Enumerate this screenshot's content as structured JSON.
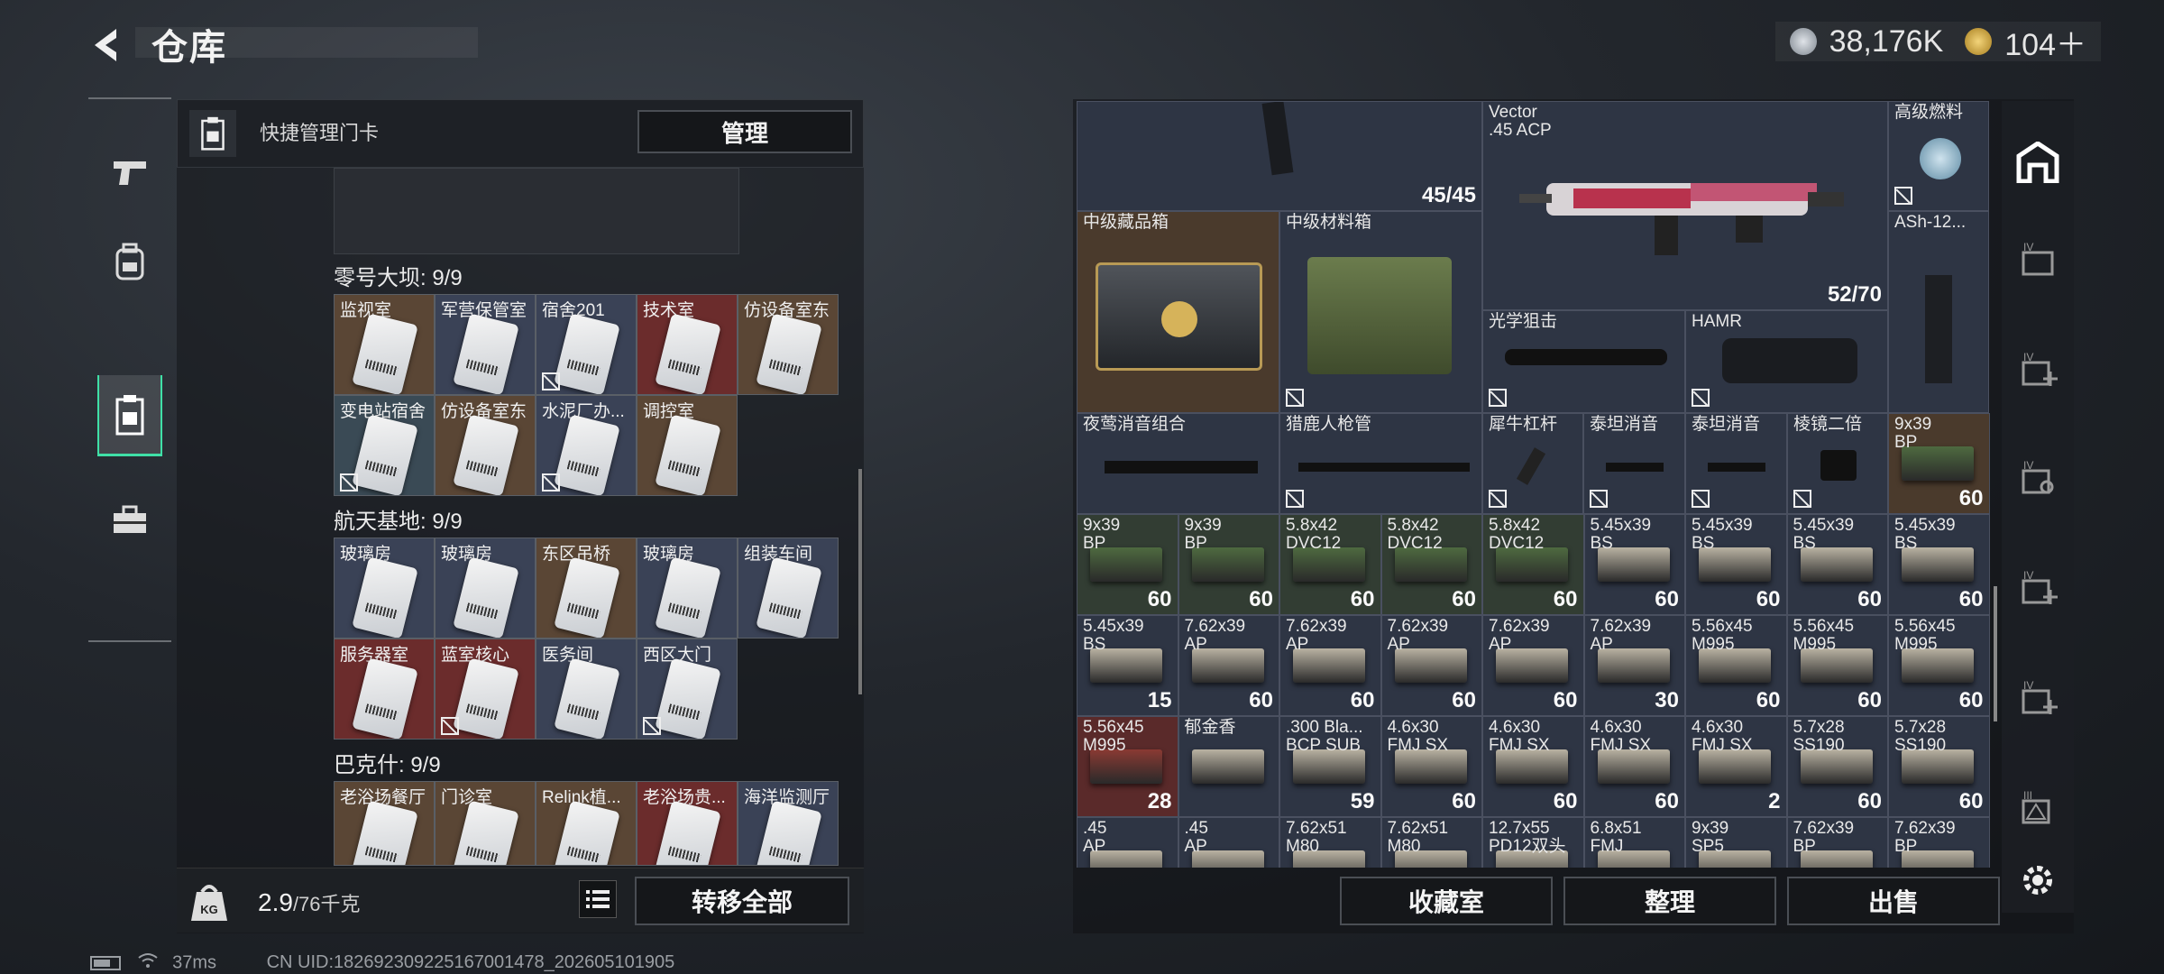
{
  "header": {
    "title": "仓库",
    "back_icon": "back-arrow-icon"
  },
  "currency": {
    "coins": "38,176K",
    "tokens": "104＋",
    "coin_color": "#9aa3ad",
    "token_color": "#c9a544"
  },
  "left": {
    "header_label": "快捷管理门卡",
    "manage_label": "管理",
    "sections": [
      {
        "label": "零号大坝: 9/9",
        "cards": [
          {
            "name": "监视室",
            "color": "brown",
            "locked": false
          },
          {
            "name": "军营保管室",
            "color": "blue",
            "locked": false
          },
          {
            "name": "宿舍201",
            "color": "blue",
            "locked": true
          },
          {
            "name": "技术室",
            "color": "red",
            "locked": false
          },
          {
            "name": "仿设备室东",
            "color": "brown",
            "locked": false
          },
          {
            "name": "变电站宿舍",
            "color": "teal",
            "locked": true
          },
          {
            "name": "仿设备室东",
            "color": "brown",
            "locked": false
          },
          {
            "name": "水泥厂办...",
            "color": "blue",
            "locked": true
          },
          {
            "name": "调控室",
            "color": "brown",
            "locked": false
          }
        ]
      },
      {
        "label": "航天基地: 9/9",
        "cards": [
          {
            "name": "玻璃房",
            "color": "blue",
            "locked": false
          },
          {
            "name": "玻璃房",
            "color": "blue",
            "locked": false
          },
          {
            "name": "东区吊桥",
            "color": "brown",
            "locked": false
          },
          {
            "name": "玻璃房",
            "color": "blue",
            "locked": false
          },
          {
            "name": "组装车间",
            "color": "blue",
            "locked": false
          },
          {
            "name": "服务器室",
            "color": "red",
            "locked": false
          },
          {
            "name": "蓝室核心",
            "color": "red",
            "locked": true
          },
          {
            "name": "医务间",
            "color": "blue",
            "locked": false
          },
          {
            "name": "西区大门",
            "color": "blue",
            "locked": true
          }
        ]
      },
      {
        "label": "巴克什: 9/9",
        "cards": [
          {
            "name": "老浴场餐厅",
            "color": "brown",
            "locked": false
          },
          {
            "name": "门诊室",
            "color": "brown",
            "locked": false
          },
          {
            "name": "Relink植...",
            "color": "brown",
            "locked": false
          },
          {
            "name": "老浴场贵...",
            "color": "red",
            "locked": false
          },
          {
            "name": "海洋监测厅",
            "color": "blue",
            "locked": false
          }
        ]
      }
    ],
    "weight": "2.9",
    "weight_max": "/76千克",
    "transfer_label": "转移全部"
  },
  "status": {
    "ping": "37ms",
    "uid": "CN UID:182692309225167001478_202605101905"
  },
  "right": {
    "top_items": [
      {
        "name": "",
        "qty": "45/45"
      },
      {
        "name": "Vector\n.45 ACP",
        "qty": "52/70"
      },
      {
        "name": "高级燃料",
        "qty": ""
      },
      {
        "name": "中级藏品箱",
        "qty": ""
      },
      {
        "name": "中级材料箱",
        "qty": ""
      },
      {
        "name": "ASh-12...",
        "qty": ""
      },
      {
        "name": "光学狙击",
        "qty": ""
      },
      {
        "name": "HAMR",
        "qty": ""
      },
      {
        "name": "夜莺消音组合",
        "qty": ""
      },
      {
        "name": "猎鹿人枪管",
        "qty": ""
      },
      {
        "name": "犀牛杠杆",
        "qty": ""
      },
      {
        "name": "泰坦消音",
        "qty": ""
      },
      {
        "name": "泰坦消音",
        "qty": ""
      },
      {
        "name": "棱镜二倍",
        "qty": ""
      }
    ],
    "ammo_rows": [
      [
        {
          "n": "9x39\nBP",
          "q": "60",
          "c": "green"
        }
      ],
      [
        {
          "n": "9x39\nBP",
          "q": "60",
          "c": "green"
        },
        {
          "n": "9x39\nBP",
          "q": "60",
          "c": "green"
        },
        {
          "n": "5.8x42\nDVC12",
          "q": "60",
          "c": "green"
        },
        {
          "n": "5.8x42\nDVC12",
          "q": "60",
          "c": "green"
        },
        {
          "n": "5.8x42\nDVC12",
          "q": "60",
          "c": "green"
        },
        {
          "n": "5.45x39\nBS",
          "q": "60",
          "c": "default"
        },
        {
          "n": "5.45x39\nBS",
          "q": "60",
          "c": "default"
        },
        {
          "n": "5.45x39\nBS",
          "q": "60",
          "c": "default"
        },
        {
          "n": "5.45x39\nBS",
          "q": "60",
          "c": "default"
        }
      ],
      [
        {
          "n": "5.45x39\nBS",
          "q": "15",
          "c": "default"
        },
        {
          "n": "7.62x39\nAP",
          "q": "60",
          "c": "default"
        },
        {
          "n": "7.62x39\nAP",
          "q": "60",
          "c": "default"
        },
        {
          "n": "7.62x39\nAP",
          "q": "60",
          "c": "default"
        },
        {
          "n": "7.62x39\nAP",
          "q": "60",
          "c": "default"
        },
        {
          "n": "7.62x39\nAP",
          "q": "30",
          "c": "default"
        },
        {
          "n": "5.56x45\nM995",
          "q": "60",
          "c": "default"
        },
        {
          "n": "5.56x45\nM995",
          "q": "60",
          "c": "default"
        },
        {
          "n": "5.56x45\nM995",
          "q": "60",
          "c": "default"
        }
      ],
      [
        {
          "n": "5.56x45\nM995",
          "q": "28",
          "c": "red"
        },
        {
          "n": "郁金香",
          "q": "",
          "c": "default"
        },
        {
          "n": ".300 Bla...\nBCP SUB",
          "q": "59",
          "c": "default"
        },
        {
          "n": "4.6x30\nFMJ SX",
          "q": "60",
          "c": "default"
        },
        {
          "n": "4.6x30\nFMJ SX",
          "q": "60",
          "c": "default"
        },
        {
          "n": "4.6x30\nFMJ SX",
          "q": "60",
          "c": "default"
        },
        {
          "n": "4.6x30\nFMJ SX",
          "q": "2",
          "c": "default"
        },
        {
          "n": "5.7x28\nSS190",
          "q": "60",
          "c": "default"
        },
        {
          "n": "5.7x28\nSS190",
          "q": "60",
          "c": "default"
        }
      ],
      [
        {
          "n": ".45\nAP",
          "q": "",
          "c": "default"
        },
        {
          "n": ".45\nAP",
          "q": "",
          "c": "default"
        },
        {
          "n": "7.62x51\nM80",
          "q": "",
          "c": "default"
        },
        {
          "n": "7.62x51\nM80",
          "q": "",
          "c": "default"
        },
        {
          "n": "12.7x55\nPD12双头",
          "q": "",
          "c": "default"
        },
        {
          "n": "6.8x51\nFMJ",
          "q": "",
          "c": "default"
        },
        {
          "n": "9x39\nSP5",
          "q": "",
          "c": "default"
        },
        {
          "n": "7.62x39\nBP",
          "q": "",
          "c": "default"
        },
        {
          "n": "7.62x39\nBP",
          "q": "",
          "c": "default"
        }
      ]
    ],
    "collection_label": "收藏室",
    "sort_label": "整理",
    "sell_label": "出售"
  }
}
